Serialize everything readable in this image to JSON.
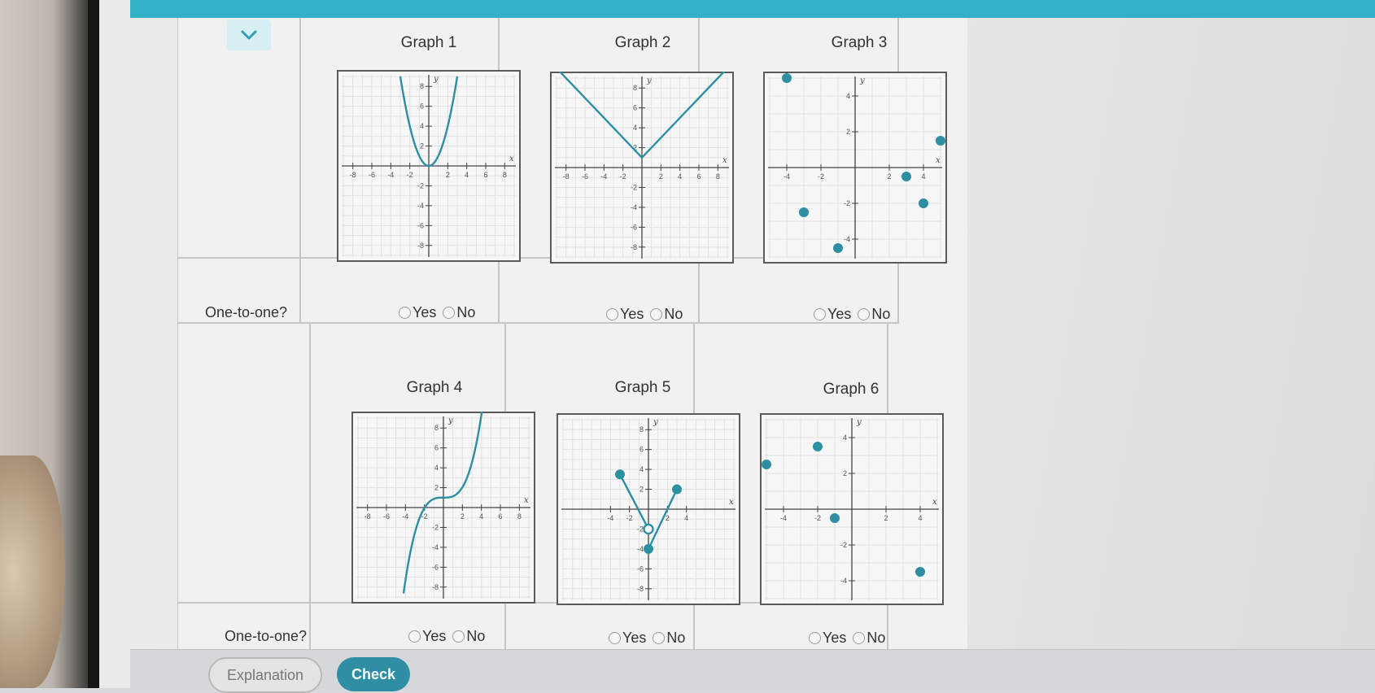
{
  "accent_color": "#32b1c9",
  "plot_color": "#2e8fa3",
  "collapse_icon": "chevron-down-icon",
  "graphs": [
    {
      "title": "Graph 1",
      "kind": "parabola",
      "x_ticks": [
        "-8",
        "-6",
        "-4",
        "-2",
        "2",
        "4",
        "6",
        "8"
      ],
      "y_ticks": [
        "8",
        "6",
        "4",
        "2",
        "-2",
        "-4",
        "-6",
        "-8"
      ]
    },
    {
      "title": "Graph 2",
      "kind": "absolute-value",
      "x_ticks": [
        "-8",
        "-6",
        "-4",
        "-2",
        "2",
        "4",
        "6",
        "8"
      ],
      "y_ticks": [
        "8",
        "6",
        "4",
        "2",
        "-2",
        "-4",
        "-6",
        "-8"
      ]
    },
    {
      "title": "Graph 3",
      "kind": "points",
      "x_ticks": [
        "-4",
        "-2",
        "2",
        "4"
      ],
      "y_ticks": [
        "4",
        "2",
        "-2",
        "-4"
      ]
    },
    {
      "title": "Graph 4",
      "kind": "cubic",
      "x_ticks": [
        "-8",
        "-6",
        "-4",
        "-2",
        "2",
        "4",
        "6",
        "8"
      ],
      "y_ticks": [
        "8",
        "6",
        "4",
        "2",
        "-2",
        "-4",
        "-6",
        "-8"
      ]
    },
    {
      "title": "Graph 5",
      "kind": "piecewise",
      "x_ticks": [
        "-4",
        "-2",
        "2",
        "4"
      ],
      "y_ticks": [
        "8",
        "6",
        "4",
        "2",
        "-2",
        "-4",
        "-6",
        "-8"
      ]
    },
    {
      "title": "Graph 6",
      "kind": "points",
      "x_ticks": [
        "-4",
        "-2",
        "2",
        "4"
      ],
      "y_ticks": [
        "4",
        "2",
        "-2",
        "-4"
      ]
    }
  ],
  "axis_labels": {
    "x": "x",
    "y": "y"
  },
  "row_label": "One-to-one?",
  "choice_yes": "Yes",
  "choice_no": "No",
  "buttons": {
    "explanation": "Explanation",
    "check": "Check"
  }
}
